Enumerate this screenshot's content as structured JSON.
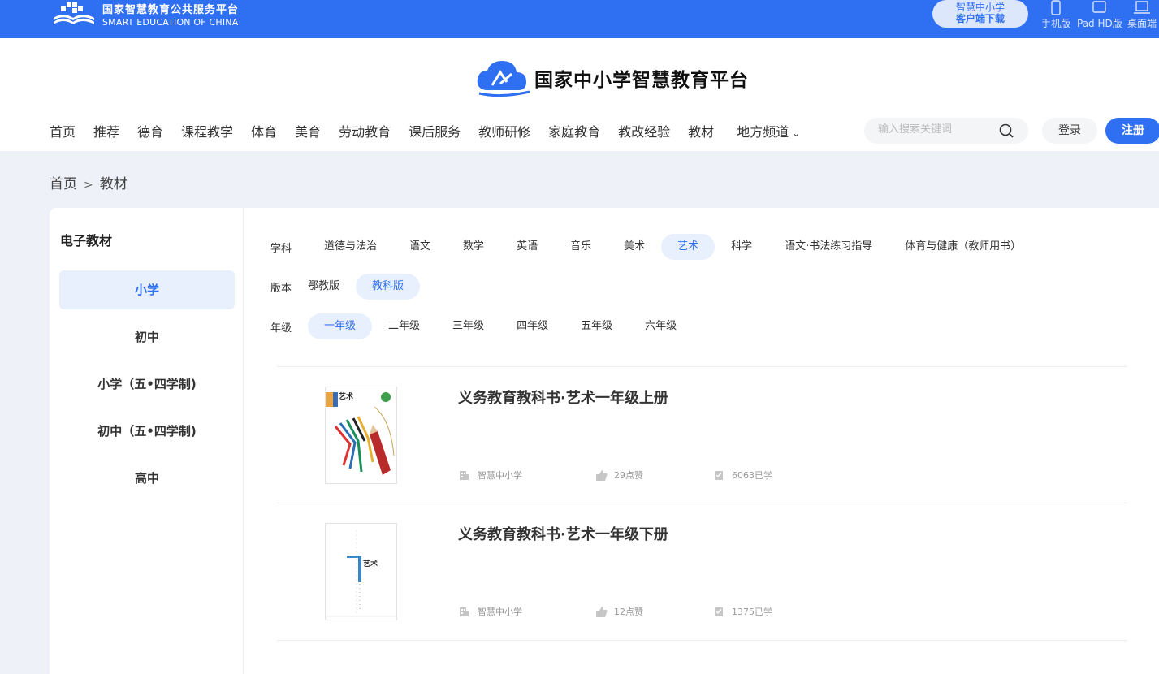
{
  "topbar": {
    "brand_cn": "国家智慧教育公共服务平台",
    "brand_en": "SMART EDUCATION OF CHINA",
    "client_line1": "智慧中小学",
    "client_line2": "客户端下载",
    "devices": [
      "手机版",
      "Pad HD版",
      "桌面端"
    ]
  },
  "header": {
    "site_title": "国家中小学智慧教育平台",
    "nav": [
      "首页",
      "推荐",
      "德育",
      "课程教学",
      "体育",
      "美育",
      "劳动教育",
      "课后服务",
      "教师研修",
      "家庭教育",
      "教改经验",
      "教材",
      "地方频道"
    ],
    "search_placeholder": "输入搜索关键词",
    "login": "登录",
    "register": "注册"
  },
  "breadcrumb": {
    "home": "首页",
    "sep": ">",
    "current": "教材"
  },
  "sidebar": {
    "title": "电子教材",
    "items": [
      "小学",
      "初中",
      "小学（五•四学制)",
      "初中（五•四学制)",
      "高中"
    ],
    "active": 0
  },
  "filters": {
    "subject": {
      "label": "学科",
      "options": [
        "道德与法治",
        "语文",
        "数学",
        "英语",
        "音乐",
        "美术",
        "艺术",
        "科学",
        "语文·书法练习指导",
        "体育与健康（教师用书）"
      ],
      "active": 6
    },
    "edition": {
      "label": "版本",
      "options": [
        "鄂教版",
        "教科版"
      ],
      "active": 1
    },
    "grade": {
      "label": "年级",
      "options": [
        "一年级",
        "二年级",
        "三年级",
        "四年级",
        "五年级",
        "六年级"
      ],
      "active": 0
    }
  },
  "books": [
    {
      "title": "义务教育教科书·艺术一年级上册",
      "source": "智慧中小学",
      "likes": "29点赞",
      "learned": "6063已学",
      "cover_text": "艺术"
    },
    {
      "title": "义务教育教科书·艺术一年级下册",
      "source": "智慧中小学",
      "likes": "12点赞",
      "learned": "1375已学",
      "cover_text": "艺术"
    }
  ],
  "colors": {
    "primary": "#2f6ff1",
    "active_bg": "#e9f0fd",
    "page_bg": "#eef1f8"
  }
}
